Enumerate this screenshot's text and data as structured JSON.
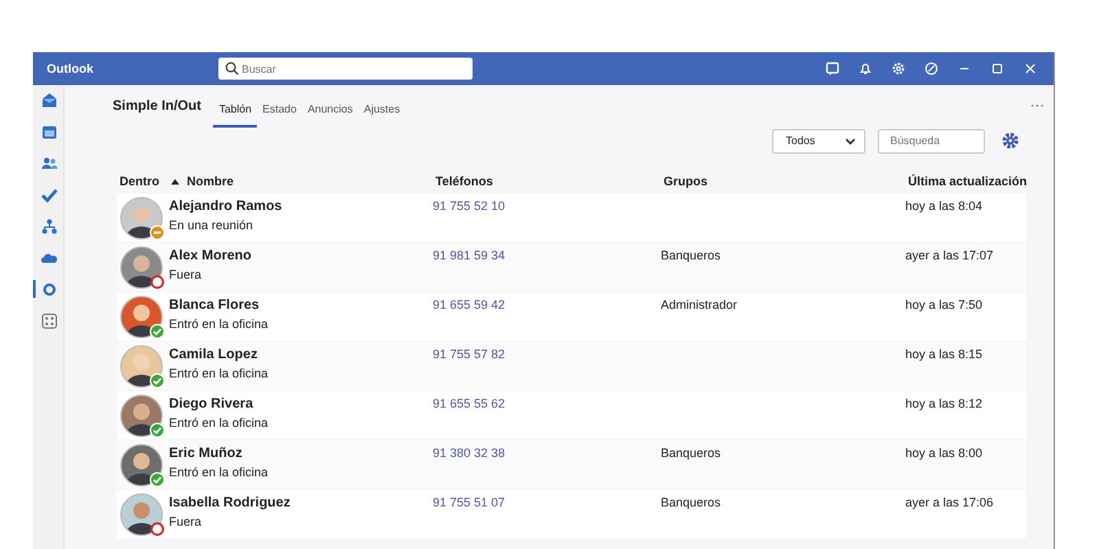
{
  "window": {
    "title": "Outlook"
  },
  "search": {
    "placeholder": "Buscar"
  },
  "sidebar": {
    "items": [
      {
        "kind": "mail",
        "selected": false
      },
      {
        "kind": "calendar",
        "selected": false
      },
      {
        "kind": "people",
        "selected": false
      },
      {
        "kind": "todo",
        "selected": false
      },
      {
        "kind": "org",
        "selected": false
      },
      {
        "kind": "cloud",
        "selected": false
      },
      {
        "kind": "app",
        "selected": true
      },
      {
        "kind": "grid",
        "selected": false
      }
    ]
  },
  "app": {
    "name": "Simple In/Out",
    "tabs": [
      {
        "label": "Tablón",
        "selected": true
      },
      {
        "label": "Estado",
        "selected": false
      },
      {
        "label": "Anuncios",
        "selected": false
      },
      {
        "label": "Ajustes",
        "selected": false
      }
    ]
  },
  "filters": {
    "group": "Todos",
    "search_placeholder": "Búsqueda"
  },
  "table": {
    "columns": [
      "Dentro",
      "Nombre",
      "Teléfonos",
      "Grupos",
      "Última actualización"
    ],
    "rows": [
      {
        "name": "Alejandro Ramos",
        "status": "En una reunión",
        "kind": "meeting",
        "phone": "91 755 52 10",
        "group": "",
        "updated": "hoy a las 8:04"
      },
      {
        "name": "Alex Moreno",
        "status": "Fuera",
        "kind": "out",
        "phone": "91 981 59 34",
        "group": "Banqueros",
        "updated": "ayer a las 17:07"
      },
      {
        "name": "Blanca Flores",
        "status": "Entró en la oficina",
        "kind": "in",
        "phone": "91 655 59 42",
        "group": "Administrador",
        "updated": "hoy a las 7:50"
      },
      {
        "name": "Camila Lopez",
        "status": "Entró en la oficina",
        "kind": "in",
        "phone": "91 755 57 82",
        "group": "",
        "updated": "hoy a las 8:15"
      },
      {
        "name": "Diego Rivera",
        "status": "Entró en la oficina",
        "kind": "in",
        "phone": "91 655 55 62",
        "group": "",
        "updated": "hoy a las 8:12"
      },
      {
        "name": "Eric Muñoz",
        "status": "Entró en la oficina",
        "kind": "in",
        "phone": "91 380 32 38",
        "group": "Banqueros",
        "updated": "hoy a las 8:00"
      },
      {
        "name": "Isabella Rodriguez",
        "status": "Fuera",
        "kind": "out",
        "phone": "91 755 51 07",
        "group": "Banqueros",
        "updated": "ayer a las 17:06"
      }
    ]
  }
}
